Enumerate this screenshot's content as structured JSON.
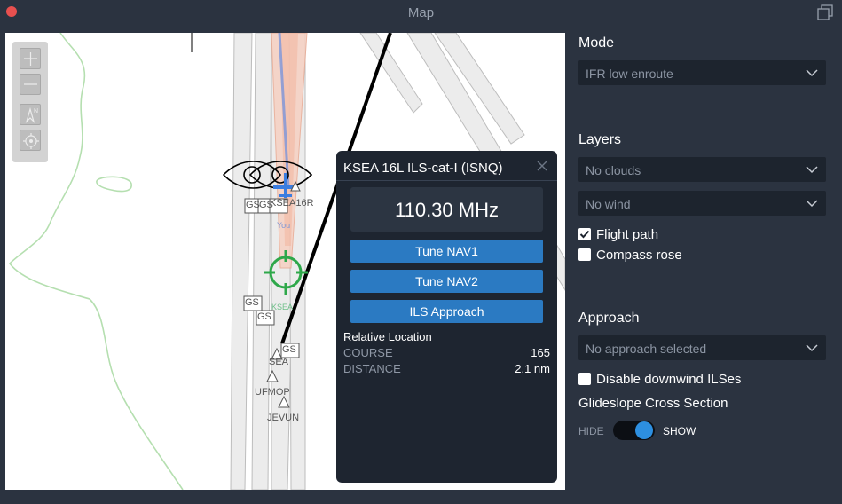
{
  "window": {
    "title": "Map"
  },
  "map": {
    "labels": {
      "ksea16r": "KSEA16R",
      "you": "You",
      "ksea": "KSEA",
      "sea": "SEA",
      "ufmop": "UFMOP",
      "jevun": "JEVUN",
      "gs": "GS",
      "compass_n": "N"
    },
    "controls": [
      "zoom-in",
      "zoom-out",
      "north-up",
      "locate"
    ]
  },
  "popup": {
    "title": "KSEA 16L ILS-cat-I (ISNQ)",
    "frequency": "110.30 MHz",
    "buttons": {
      "tune_nav1": "Tune NAV1",
      "tune_nav2": "Tune NAV2",
      "ils_approach": "ILS Approach"
    },
    "relative_location": {
      "heading": "Relative Location",
      "course_label": "COURSE",
      "course_value": "165",
      "distance_label": "DISTANCE",
      "distance_value": "2.1 nm"
    }
  },
  "panel": {
    "mode": {
      "label": "Mode",
      "value": "IFR low enroute"
    },
    "layers": {
      "label": "Layers",
      "clouds": "No clouds",
      "wind": "No wind",
      "flight_path": {
        "label": "Flight path",
        "checked": true
      },
      "compass_rose": {
        "label": "Compass rose",
        "checked": false
      }
    },
    "approach": {
      "label": "Approach",
      "placeholder": "No approach selected",
      "disable_downwind": {
        "label": "Disable downwind ILSes",
        "checked": false
      },
      "glideslope_label": "Glideslope Cross Section",
      "toggle": {
        "hide": "HIDE",
        "show": "SHOW",
        "state": "SHOW"
      }
    }
  },
  "colors": {
    "accent": "#2b7ac2",
    "toggle": "#2d8fe0",
    "close": "#e8504f",
    "background": "#2b3340"
  }
}
